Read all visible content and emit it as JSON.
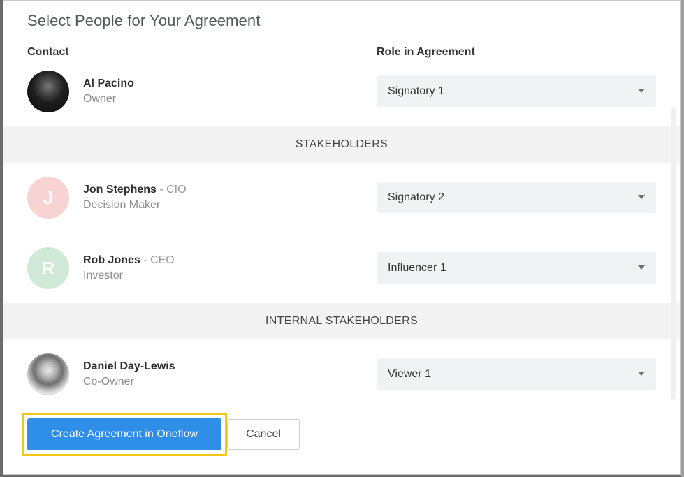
{
  "dialog": {
    "title": "Select People for Your Agreement",
    "columns": {
      "contact": "Contact",
      "role": "Role in Agreement"
    }
  },
  "owner": {
    "name": "Al Pacino",
    "subtitle": "Owner",
    "role": "Signatory 1",
    "avatar_icon": "person-photo-icon"
  },
  "sections": {
    "stakeholders": "STAKEHOLDERS",
    "internal": "INTERNAL STAKEHOLDERS"
  },
  "stakeholders": [
    {
      "initial": "J",
      "name": "Jon Stephens",
      "job_title": " - CIO",
      "subtitle": "Decision Maker",
      "role": "Signatory 2",
      "avatar_color": "#f7d3d3"
    },
    {
      "initial": "R",
      "name": "Rob Jones",
      "job_title": " - CEO",
      "subtitle": "Investor",
      "role": "Influencer 1",
      "avatar_color": "#cfe9d6"
    }
  ],
  "internal": [
    {
      "name": "Daniel Day-Lewis",
      "subtitle": "Co-Owner",
      "role": "Viewer 1",
      "avatar_icon": "person-photo-icon"
    }
  ],
  "actions": {
    "create_label": "Create Agreement in Oneflow",
    "cancel_label": "Cancel"
  },
  "colors": {
    "primary": "#2f8ee8",
    "focus_ring": "#f5c518",
    "section_bg": "#f3f3f4"
  }
}
